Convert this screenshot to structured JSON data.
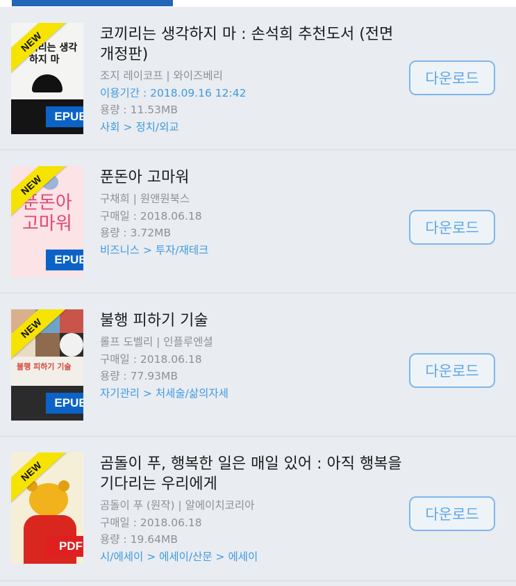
{
  "colors": {
    "tab_indicator": "#2166b8",
    "list_bg": "#e9ecf1",
    "title": "#1b1b1b",
    "meta_gray": "#8d9096",
    "link_blue": "#3f9ae0",
    "button_border": "#7db7ec",
    "new_ribbon": "#f6e300",
    "epub_badge": "#0b63c7",
    "pdf_badge": "#e02020"
  },
  "books": [
    {
      "title": "코끼리는 생각하지 마 : 손석희 추천도서 (전면개정판)",
      "author_publisher": "조지 레이코프 | 와이즈베리",
      "date_line": "이용기간 : 2018.09.16 12:42",
      "size": "용량 : 11.53MB",
      "category": "사회 > 정치/외교",
      "ribbon": "NEW",
      "format": "EPUB",
      "cover_text": "끼리는 생각하지 마",
      "download_label": "다운로드"
    },
    {
      "title": "푼돈아 고마워",
      "author_publisher": "구채희 | 원앤원북스",
      "date_line": "구매일 : 2018.06.18",
      "size": "용량 : 3.72MB",
      "category": "비즈니스 > 투자/재테크",
      "ribbon": "NEW",
      "format": "EPUB",
      "cover_text": "푼돈아 고마워",
      "download_label": "다운로드"
    },
    {
      "title": "불행 피하기 기술",
      "author_publisher": "롤프 도벨리 | 인플루엔셜",
      "date_line": "구매일 : 2018.06.18",
      "size": "용량 : 77.93MB",
      "category": "자기관리 > 처세술/삶의자세",
      "ribbon": "NEW",
      "format": "EPUB",
      "cover_text": "불행 피하기 기술",
      "download_label": "다운로드"
    },
    {
      "title": "곰돌이 푸, 행복한 일은 매일 있어 : 아직 행복을 기다리는 우리에게",
      "author_publisher": "곰돌이 푸 (원작) | 알에이치코리아",
      "date_line": "구매일 : 2018.06.18",
      "size": "용량 : 19.64MB",
      "category": "시/에세이 > 에세이/산문 > 에세이",
      "ribbon": "NEW",
      "format": "PDF",
      "cover_text": "",
      "download_label": "다운로드"
    }
  ]
}
